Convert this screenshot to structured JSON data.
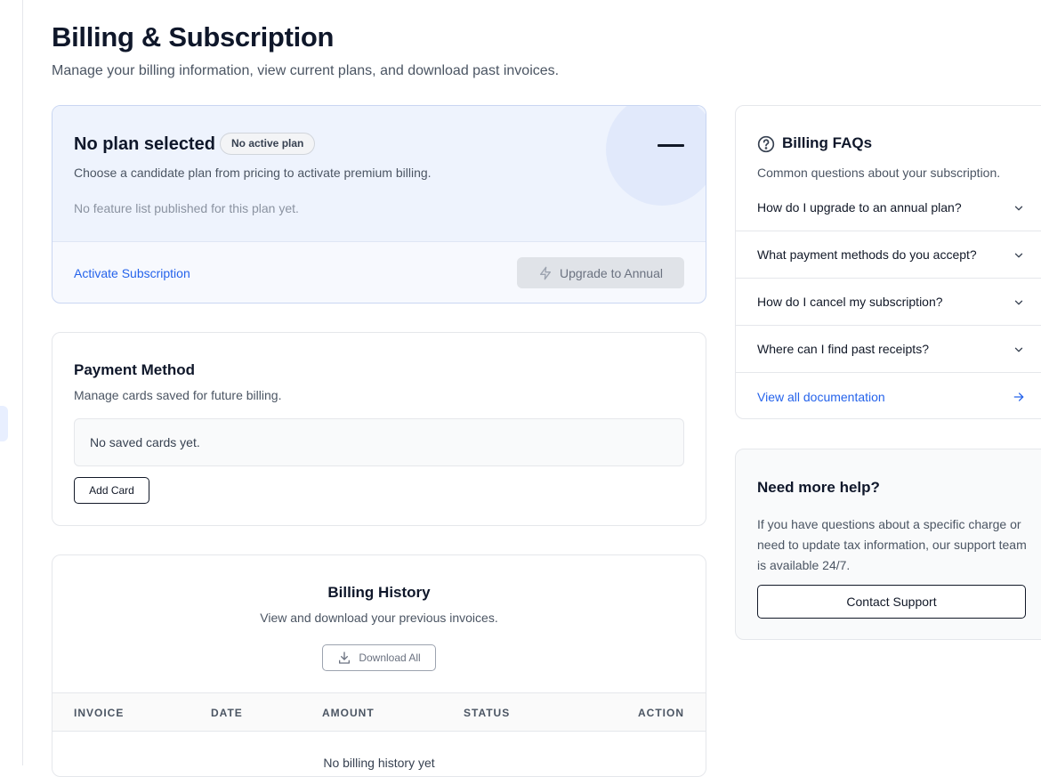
{
  "page": {
    "title": "Billing & Subscription",
    "subtitle": "Manage your billing information, view current plans, and download past invoices."
  },
  "plan": {
    "title": "No plan selected",
    "badge": "No active plan",
    "description": "Choose a candidate plan from pricing to activate premium billing.",
    "features_empty": "No feature list published for this plan yet.",
    "activate_label": "Activate Subscription",
    "upgrade_label": "Upgrade to Annual",
    "upgrade_icon": "lightning-icon",
    "status_icon": "dash-icon"
  },
  "payment": {
    "title": "Payment Method",
    "description": "Manage cards saved for future billing.",
    "empty": "No saved cards yet.",
    "add_label": "Add Card"
  },
  "history": {
    "title": "Billing History",
    "description": "View and download your previous invoices.",
    "download_label": "Download All",
    "download_icon": "download-icon",
    "columns": [
      "INVOICE",
      "DATE",
      "AMOUNT",
      "STATUS",
      "ACTION"
    ],
    "empty": "No billing history yet"
  },
  "faq": {
    "title": "Billing FAQs",
    "icon": "question-circle-icon",
    "description": "Common questions about your subscription.",
    "items": [
      "How do I upgrade to an annual plan?",
      "What payment methods do you accept?",
      "How do I cancel my subscription?",
      "Where can I find past receipts?"
    ],
    "docs_label": "View all documentation",
    "docs_icon": "arrow-right-icon"
  },
  "help": {
    "title": "Need more help?",
    "text": "If you have questions about a specific charge or need to update tax information, our support team is available 24/7.",
    "button_label": "Contact Support"
  },
  "colors": {
    "accent": "#2563eb",
    "plan_background": "#eef3fd",
    "text_primary": "#0f172a"
  }
}
